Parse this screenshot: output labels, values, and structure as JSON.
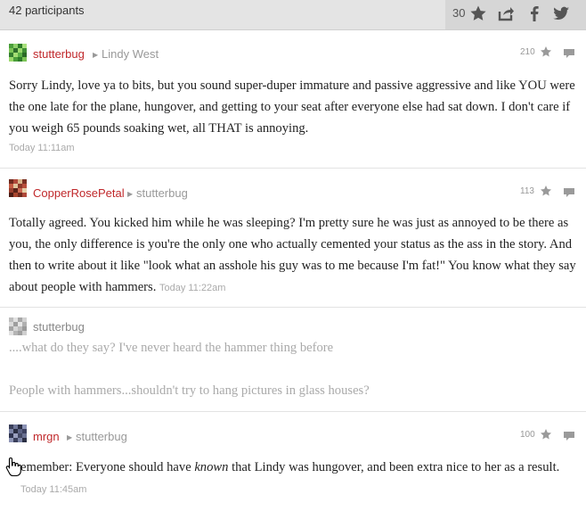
{
  "header": {
    "participants": "42 participants",
    "star_count": "30",
    "icons": [
      "star-icon",
      "share-icon",
      "facebook-icon",
      "twitter-icon"
    ]
  },
  "comments": [
    {
      "author": "stutterbug",
      "reply_to": "Lindy West",
      "likes": "210",
      "text": "Sorry Lindy, love ya to bits, but you sound super-duper immature and passive aggressive and like YOU were the one late for the plane, hungover, and getting to your seat after everyone else had sat down. I don't care if you weigh 65 pounds soaking wet, all THAT is annoying.",
      "time": "Today 11:11am"
    },
    {
      "author": "CopperRosePetal",
      "reply_to": "stutterbug",
      "likes": "113",
      "text": "Totally agreed. You kicked him while he was sleeping? I'm pretty sure he was just as annoyed to be there as you, the only difference is you're the only one who actually cemented your status as the ass in the story. And then to write about it like \"look what an asshole his guy was to me because I'm fat!\" You know what they say about people with hammers.",
      "time": "Today 11:22am"
    },
    {
      "author": "stutterbug",
      "line1": "....what do they say? I've never heard the hammer thing before",
      "line2": "People with hammers...shouldn't try to hang pictures in glass houses?"
    },
    {
      "author": "mrgn",
      "reply_to": "stutterbug",
      "likes": "100",
      "text_before": "emember: Everyone should have ",
      "text_em": "known",
      "text_after": " that Lindy was hungover, and been extra nice to her as a result.",
      "time": "Today 11:45am"
    }
  ],
  "colors": {
    "author": "#c0282b",
    "muted": "#aaaaaa",
    "topbar": "#e4e4e4"
  }
}
